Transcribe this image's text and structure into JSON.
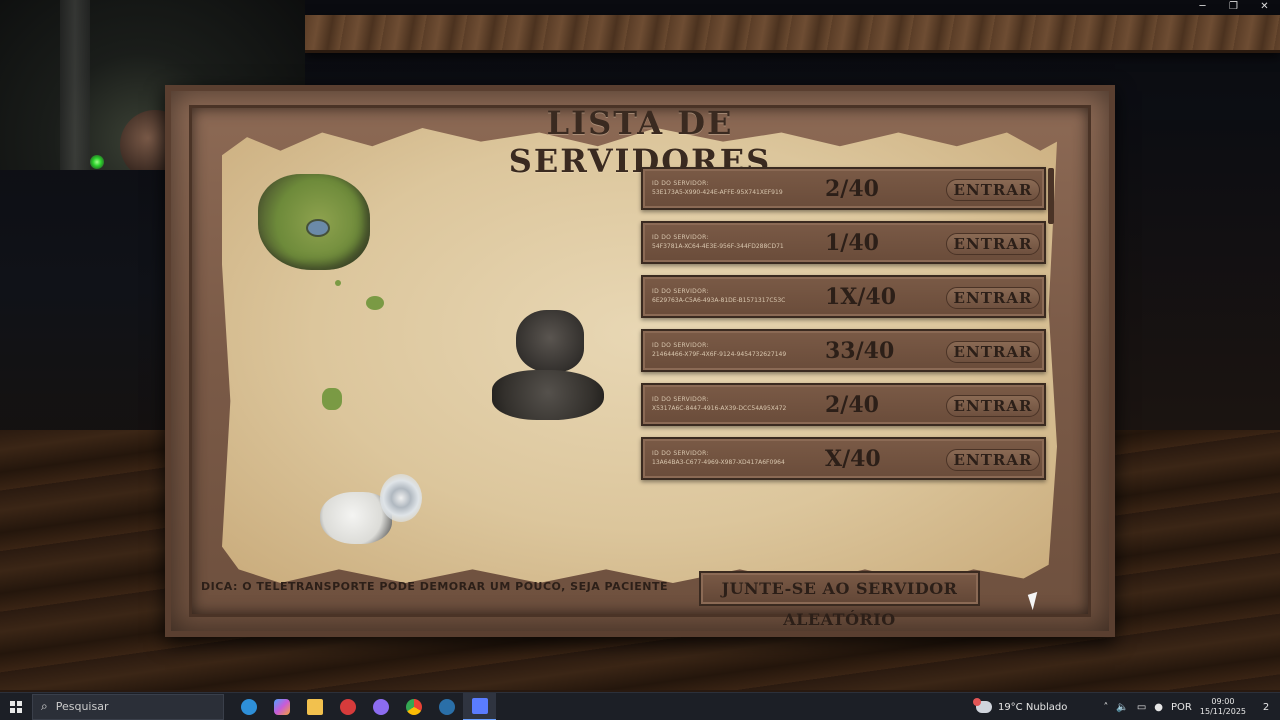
{
  "window": {
    "minimize": "─",
    "restore": "❐",
    "close": "✕"
  },
  "game": {
    "title": "LISTA DE SERVIDORES",
    "servers": [
      {
        "id_label": "ID DO SERVIDOR:",
        "id": "53E173A5-X990-424E-AFFE-95X741XEF919",
        "count": "2/40",
        "join": "ENTRAR"
      },
      {
        "id_label": "ID DO SERVIDOR:",
        "id": "54F3781A-XC64-4E3E-956F-344FD288CD71",
        "count": "1/40",
        "join": "ENTRAR"
      },
      {
        "id_label": "ID DO SERVIDOR:",
        "id": "6E29763A-C5A6-493A-81DE-B1571317C53C",
        "count": "1X/40",
        "join": "ENTRAR"
      },
      {
        "id_label": "ID DO SERVIDOR:",
        "id": "21464466-X79F-4X6F-9124-9454732627149",
        "count": "33/40",
        "join": "ENTRAR"
      },
      {
        "id_label": "ID DO SERVIDOR:",
        "id": "X5317A6C-8447-4916-AX39-DCC54A95X472",
        "count": "2/40",
        "join": "ENTRAR"
      },
      {
        "id_label": "ID DO SERVIDOR:",
        "id": "13A64BA3-C677-4969-X987-XD417A6F0964",
        "count": "X/40",
        "join": "ENTRAR"
      }
    ],
    "tip": "DICA: O TELETRANSPORTE PODE DEMORAR UM POUCO, SEJA PACIENTE",
    "random_button": "JUNTE-SE AO SERVIDOR ALEATÓRIO"
  },
  "taskbar": {
    "search_placeholder": "Pesquisar",
    "apps": [
      {
        "name": "edge",
        "color": "#2e8fd8"
      },
      {
        "name": "copilot",
        "color": "#c85bd8"
      },
      {
        "name": "explorer",
        "color": "#f2c14e"
      },
      {
        "name": "app-red",
        "color": "#d63b3b"
      },
      {
        "name": "discord",
        "color": "#8c6cf0"
      },
      {
        "name": "chrome",
        "color": "#3cb55a"
      },
      {
        "name": "steam",
        "color": "#2a6fa8"
      },
      {
        "name": "roblox",
        "color": "#5a7cff"
      }
    ],
    "weather": "19°C  Nublado",
    "lang": "POR",
    "time": "09:00",
    "date": "15/11/2025",
    "notifications": "2"
  }
}
